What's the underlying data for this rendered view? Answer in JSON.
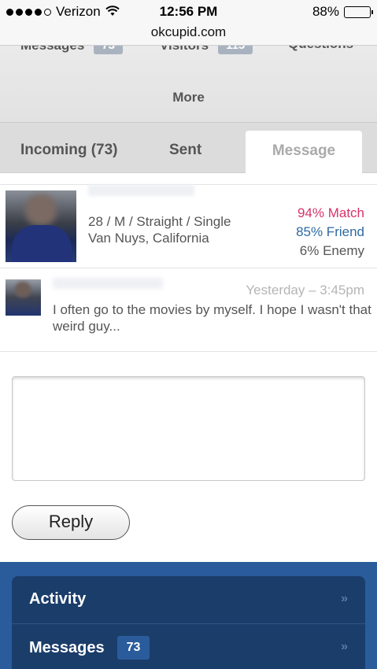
{
  "status_bar": {
    "carrier": "Verizon",
    "time": "12:56 PM",
    "battery": "88%",
    "battery_level": 0.88
  },
  "url": "okcupid.com",
  "top_nav": {
    "items": [
      {
        "label": "Messages",
        "count": "73"
      },
      {
        "label": "Visitors",
        "count": "115"
      },
      {
        "label": "Questions"
      }
    ],
    "more": "More"
  },
  "tabs": [
    {
      "label": "Incoming (73)"
    },
    {
      "label": "Sent"
    },
    {
      "label": "Message",
      "active": true
    }
  ],
  "profile": {
    "details_line1": "28 / M / Straight / Single",
    "details_line2": "Van Nuys, California",
    "match": "94% Match",
    "friend": "85% Friend",
    "enemy": "6% Enemy"
  },
  "message": {
    "time": "Yesterday – 3:45pm",
    "text": "I often go to the movies by myself. I hope I wasn't that weird guy..."
  },
  "reply": {
    "button": "Reply"
  },
  "bottom_nav": {
    "items": [
      {
        "label": "Activity",
        "chevron": "»"
      },
      {
        "label": "Messages",
        "count": "73",
        "chevron": "»"
      }
    ]
  },
  "colors": {
    "match": "#d6336c",
    "friend": "#2f6aa3",
    "enemy": "#555555",
    "bottom_bg": "#2a5c9c",
    "bottom_panel": "#1b3d6a"
  }
}
